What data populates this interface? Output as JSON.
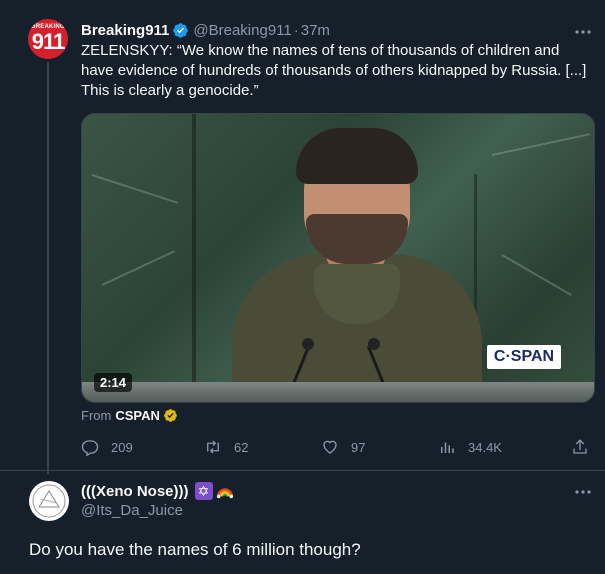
{
  "tweet": {
    "avatar_text_small": "BREAKING",
    "avatar_text_big": "911",
    "name": "Breaking911",
    "handle": "@Breaking911",
    "separator": "·",
    "time": "37m",
    "text": "ZELENSKYY: “We know the names of tens of thousands of children and have evidence of hundreds of thousands of others kidnapped by Russia. [...] This is clearly a genocide.”",
    "media": {
      "duration": "2:14",
      "watermark": "C·SPAN"
    },
    "from_label": "From",
    "from_source": "CSPAN",
    "actions": {
      "replies": "209",
      "retweets": "62",
      "likes": "97",
      "views": "34.4K"
    }
  },
  "reply": {
    "name": "(((Xeno Nose)))",
    "badge_star": "✡",
    "handle": "@Its_Da_Juice",
    "text": "Do you have the names of 6 million though?"
  },
  "colors": {
    "background": "#15202b",
    "text_primary": "#f7f9f9",
    "text_secondary": "#8b98a5",
    "verified_blue": "#1d9bf0",
    "gold_check": "#e2b719",
    "divider": "#38444d"
  }
}
